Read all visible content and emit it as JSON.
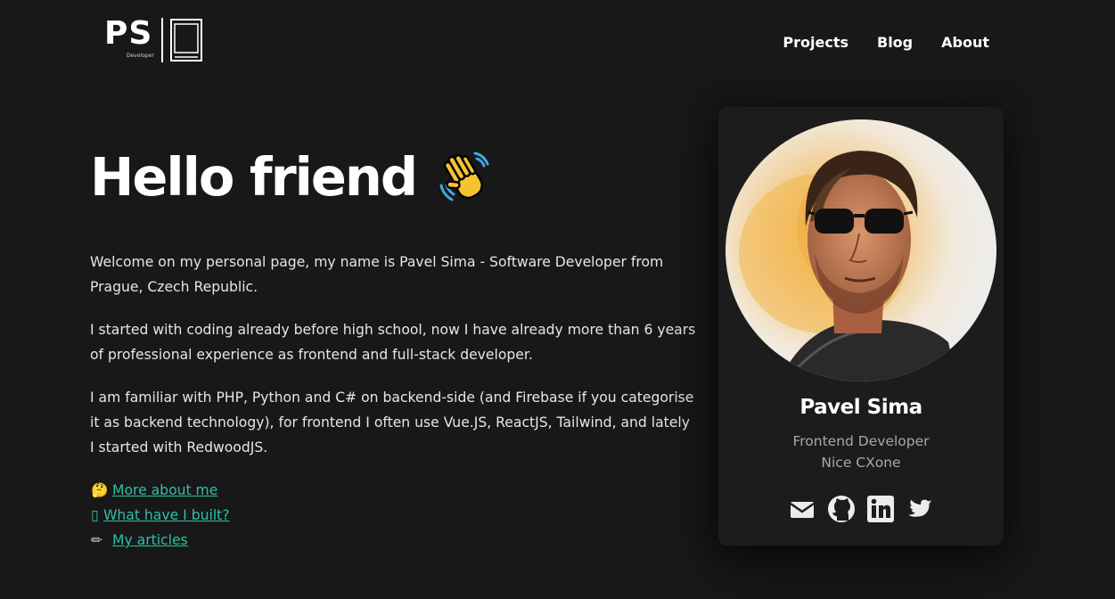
{
  "header": {
    "logo_text": "PS",
    "logo_sub": "Developer",
    "nav": [
      {
        "label": "Projects"
      },
      {
        "label": "Blog"
      },
      {
        "label": "About"
      }
    ]
  },
  "hero": {
    "title": "Hello friend",
    "title_icon": "waving-hand-icon"
  },
  "intro": {
    "paragraphs": [
      "Welcome on my personal page, my name is Pavel Sima - Software Developer from Prague, Czech Republic.",
      "I started with coding already before high school, now I have already more than 6 years of professional experience as frontend and full-stack developer.",
      "I am familiar with PHP, Python and C# on backend-side (and Firebase if you categorise it as backend technology), for frontend I often use Vue.JS, ReactJS, Tailwind, and lately I started with RedwoodJS."
    ]
  },
  "links": [
    {
      "icon": "thinking-face-icon",
      "glyph": "🤔",
      "label": "More about me"
    },
    {
      "icon": "missing-glyph-icon",
      "glyph": "▯",
      "label": "What have I built?"
    },
    {
      "icon": "pencil-icon",
      "glyph": "✏",
      "label": "My articles"
    }
  ],
  "profile": {
    "name": "Pavel Sima",
    "role": "Frontend Developer",
    "company": "Nice CXone",
    "socials": [
      "mail-icon",
      "github-icon",
      "linkedin-icon",
      "twitter-icon"
    ]
  },
  "colors": {
    "background": "#181818",
    "link": "#2cc1a6",
    "card": "#1c1c1c",
    "muted_text": "#a9a9a9"
  }
}
